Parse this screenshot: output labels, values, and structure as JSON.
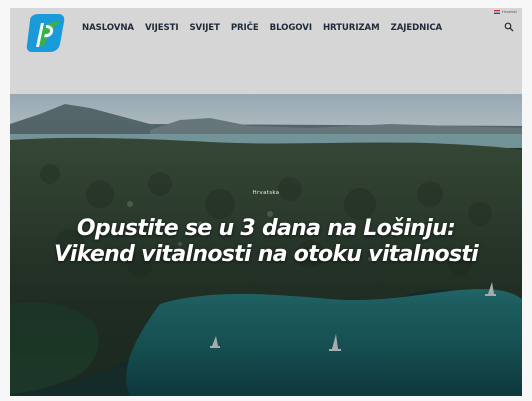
{
  "header": {
    "logo_icon": "fp-logo-icon",
    "nav_items": [
      "NASLOVNA",
      "VIJESTI",
      "SVIJET",
      "PRIČE",
      "BLOGOVI",
      "HRTURIZAM",
      "ZAJEDNICA"
    ],
    "search_icon": "search-icon",
    "language_label": "Hrvatski"
  },
  "hero": {
    "category": "Hrvatska",
    "title": "Opustite se u 3 dana na Lošinju: Vikend vitalnosti na otoku vitalnosti"
  },
  "colors": {
    "header_bg": "#d6d6d6",
    "logo_blue": "#1a9ad8",
    "logo_green": "#37b24a",
    "nav_text": "#1f2b3a",
    "sea": "#1f6f73",
    "title_text": "#ffffff"
  }
}
